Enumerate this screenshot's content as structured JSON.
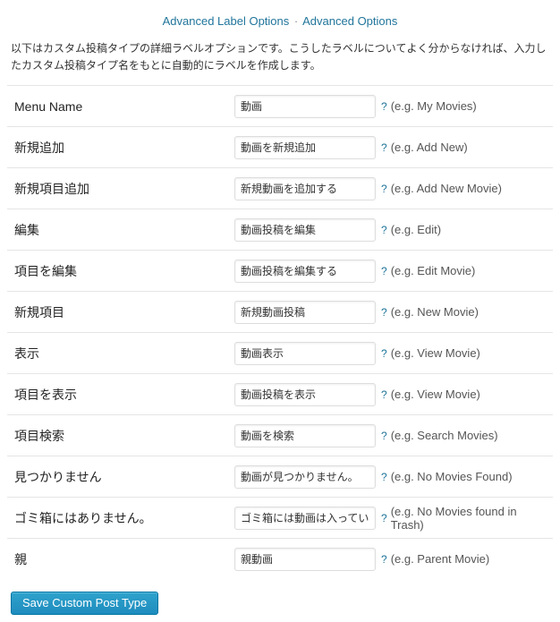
{
  "tabs": {
    "advanced_label": "Advanced Label Options",
    "separator": "·",
    "advanced": "Advanced Options"
  },
  "description": "以下はカスタム投稿タイプの詳細ラベルオプションです。こうしたラベルについてよく分からなければ、入力したカスタム投稿タイプ名をもとに自動的にラベルを作成します。",
  "help_symbol": "?",
  "fields": {
    "menu_name": {
      "label": "Menu Name",
      "value": "動画",
      "hint": "(e.g. My Movies)"
    },
    "add_new": {
      "label": "新規追加",
      "value": "動画を新規追加",
      "hint": "(e.g. Add New)"
    },
    "add_new_item": {
      "label": "新規項目追加",
      "value": "新規動画を追加する",
      "hint": "(e.g. Add New Movie)"
    },
    "edit": {
      "label": "編集",
      "value": "動画投稿を編集",
      "hint": "(e.g. Edit)"
    },
    "edit_item": {
      "label": "項目を編集",
      "value": "動画投稿を編集する",
      "hint": "(e.g. Edit Movie)"
    },
    "new_item": {
      "label": "新規項目",
      "value": "新規動画投稿",
      "hint": "(e.g. New Movie)"
    },
    "view": {
      "label": "表示",
      "value": "動画表示",
      "hint": "(e.g. View Movie)"
    },
    "view_item": {
      "label": "項目を表示",
      "value": "動画投稿を表示",
      "hint": "(e.g. View Movie)"
    },
    "search_items": {
      "label": "項目検索",
      "value": "動画を検索",
      "hint": "(e.g. Search Movies)"
    },
    "not_found": {
      "label": "見つかりません",
      "value": "動画が見つかりません。",
      "hint": "(e.g. No Movies Found)"
    },
    "not_in_trash": {
      "label": "ゴミ箱にはありません。",
      "value": "ゴミ箱には動画は入っていません。",
      "hint": "(e.g. No Movies found in Trash)"
    },
    "parent": {
      "label": "親",
      "value": "親動画",
      "hint": "(e.g. Parent Movie)"
    }
  },
  "submit": {
    "label": "Save Custom Post Type"
  }
}
